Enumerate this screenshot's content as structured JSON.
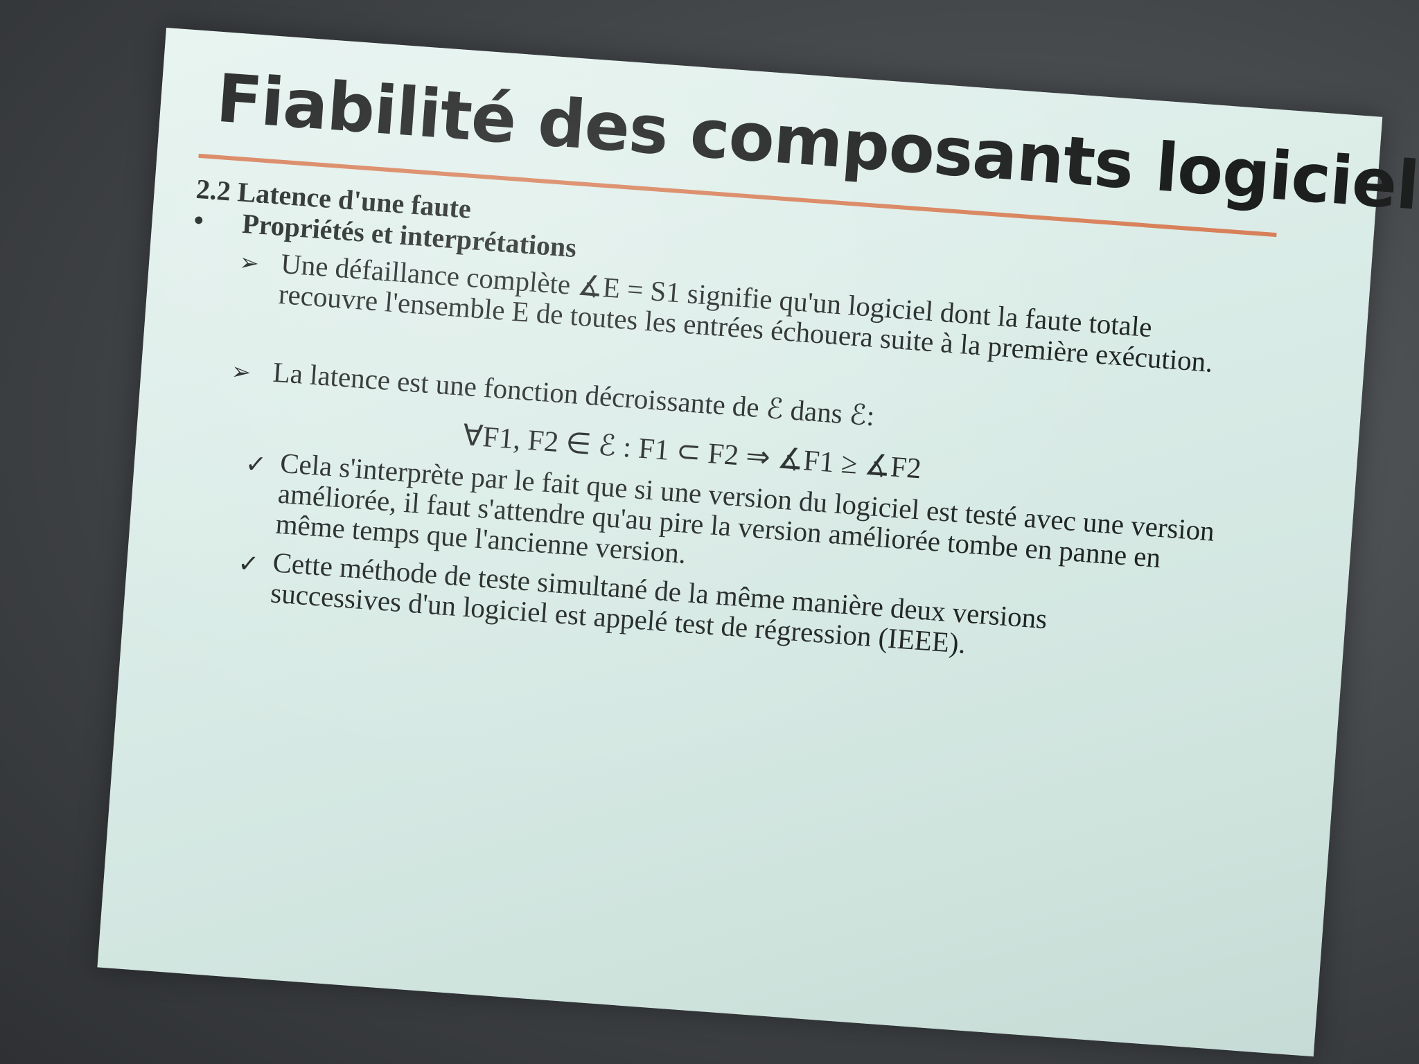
{
  "slide": {
    "title": "Fiabilité des composants logiciels",
    "section": "2.2 Latence d'une faute",
    "subsection_bullet": "•",
    "subsection": "Propriétés et interprétations",
    "arrow_glyph": "➢",
    "check_glyph": "✓",
    "point1": "Une défaillance complète ∡E = S1 signifie qu'un logiciel dont la faute totale recouvre l'ensemble E de toutes les entrées échouera suite à la première exécution.",
    "point2": "La latence est une fonction décroissante de ℰ dans ℰ:",
    "formula": "∀F1, F2 ∈ ℰ :    F1 ⊂ F2 ⇒ ∡F1 ≥ ∡F2",
    "check1": "Cela s'interprète par le fait que si une version du logiciel est testé avec une version améliorée, il faut s'attendre qu'au pire la version améliorée tombe en panne en même temps que l'ancienne version.",
    "check2": "Cette méthode de teste simultané de la même manière deux versions successives d'un logiciel est appelé test de régression (IEEE)."
  },
  "colors": {
    "slide_background": "#dcefe9",
    "title_rule": "#d7744a",
    "text": "#1e2422",
    "surround": "#4a4d50"
  }
}
